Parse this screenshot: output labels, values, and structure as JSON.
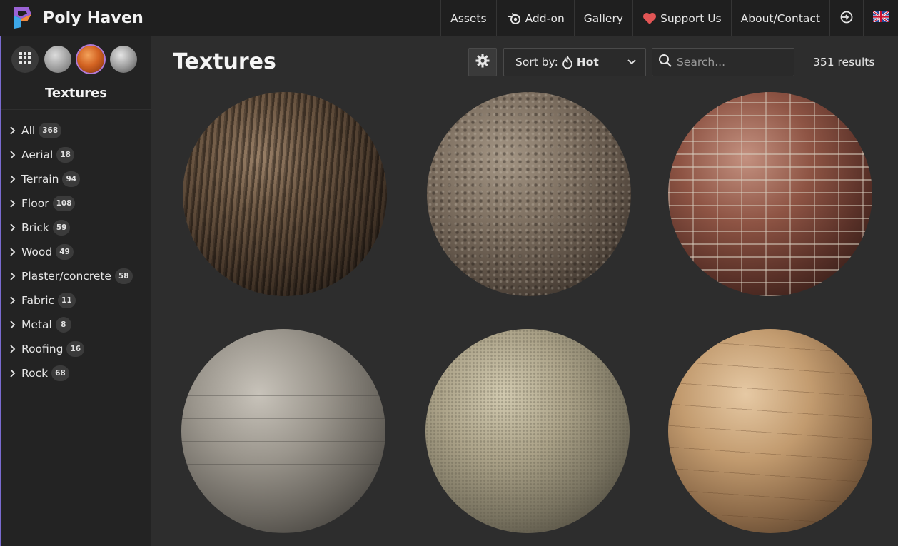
{
  "brand": {
    "name": "Poly Haven"
  },
  "nav": {
    "assets": "Assets",
    "addon": "Add-on",
    "gallery": "Gallery",
    "support": "Support Us",
    "about": "About/Contact"
  },
  "sidebar": {
    "title": "Textures",
    "types": [
      "all-types",
      "hdris",
      "textures",
      "models"
    ],
    "categories": [
      {
        "label": "All",
        "count": "368"
      },
      {
        "label": "Aerial",
        "count": "18"
      },
      {
        "label": "Terrain",
        "count": "94"
      },
      {
        "label": "Floor",
        "count": "108"
      },
      {
        "label": "Brick",
        "count": "59"
      },
      {
        "label": "Wood",
        "count": "49"
      },
      {
        "label": "Plaster/concrete",
        "count": "58"
      },
      {
        "label": "Fabric",
        "count": "11"
      },
      {
        "label": "Metal",
        "count": "8"
      },
      {
        "label": "Roofing",
        "count": "16"
      },
      {
        "label": "Rock",
        "count": "68"
      }
    ]
  },
  "main": {
    "title": "Textures",
    "sort_label": "Sort by:",
    "sort_value": "Hot",
    "search_placeholder": "Search...",
    "results": "351 results"
  },
  "colors": {
    "topbar": "#1f1f1f",
    "sidebar": "#232323",
    "main_bg": "#2d2d2d",
    "heart": "#e25555",
    "accent": "#7a6bd0"
  },
  "icons": [
    "logo-icon",
    "blender-icon",
    "heart-icon",
    "login-icon",
    "flag-uk-icon",
    "grid-icon",
    "gear-icon",
    "flame-icon",
    "chevron-down-icon",
    "search-icon",
    "chevron-right-icon"
  ]
}
